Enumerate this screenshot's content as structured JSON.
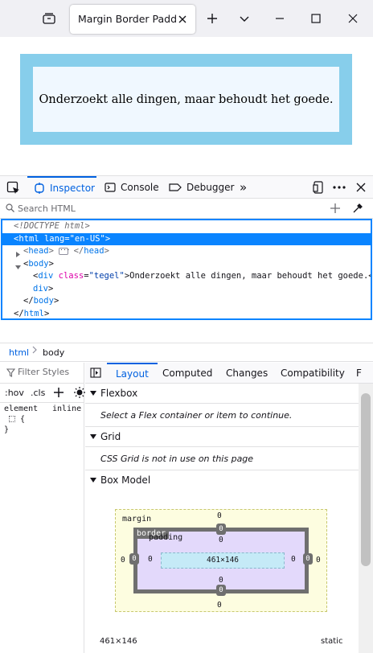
{
  "browser": {
    "tab_title": "Margin Border Padding"
  },
  "page": {
    "text": "Onderzoekt alle dingen, maar behoudt het goede."
  },
  "devtools": {
    "tabs": {
      "inspector": "Inspector",
      "console": "Console",
      "debugger": "Debugger",
      "more": "»"
    },
    "search_placeholder": "Search HTML",
    "markup": {
      "doctype": "<!DOCTYPE html>",
      "html_tag": "html",
      "html_attr": "lang",
      "html_val": "\"en-US\"",
      "head_tag": "head",
      "body_tag": "body",
      "div_tag": "div",
      "div_attr": "class",
      "div_val": "\"tegel\"",
      "div_text": "Onderzoekt alle dingen, maar behoudt het goede.",
      "div_close": "div"
    },
    "breadcrumb": [
      "html",
      "body"
    ],
    "rules": {
      "filter_placeholder": "Filter Styles",
      "hov": ":hov",
      "cls": ".cls",
      "selector": "element",
      "origin": "inline",
      "open_brace": "{",
      "close_brace": "}"
    },
    "side_tabs": [
      "Layout",
      "Computed",
      "Changes",
      "Compatibility",
      "F"
    ],
    "sections": {
      "flexbox": "Flexbox",
      "flexbox_msg": "Select a Flex container or item to continue.",
      "grid": "Grid",
      "grid_msg": "CSS Grid is not in use on this page",
      "box_model": "Box Model"
    },
    "box_model": {
      "margin_label": "margin",
      "border_label": "border",
      "padding_label": "padding",
      "content_size": "461×146",
      "zero": "0",
      "footer_size": "461×146",
      "position": "static"
    }
  }
}
